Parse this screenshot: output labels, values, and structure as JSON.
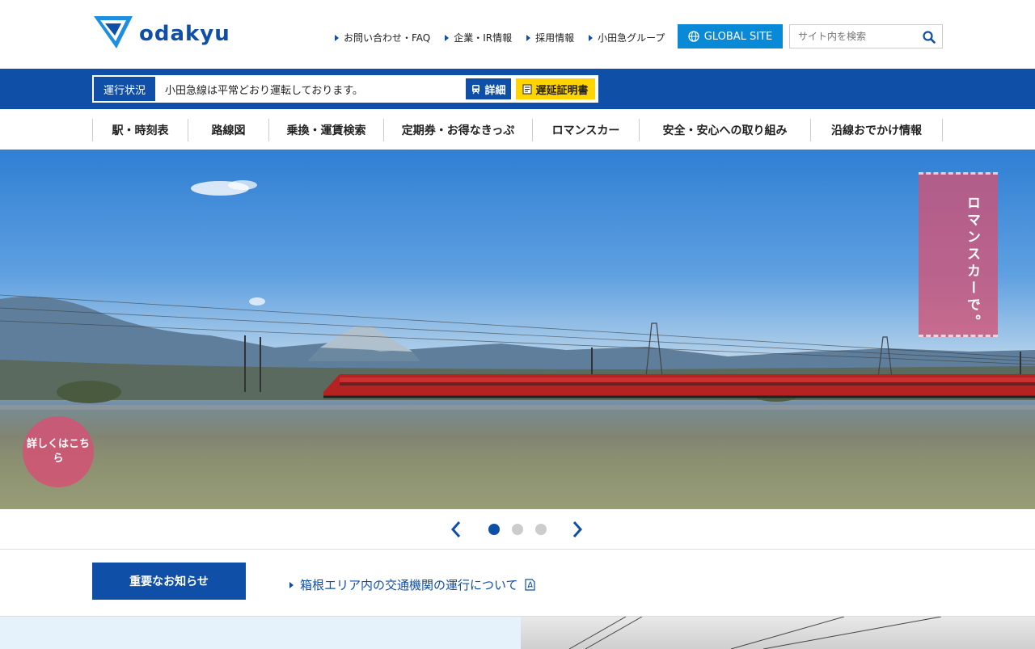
{
  "header": {
    "logo_text": "odakyu",
    "util_links": [
      "お問い合わせ・FAQ",
      "企業・IR情報",
      "採用情報",
      "小田急グループ"
    ],
    "global_site_label": "GLOBAL SITE",
    "search_placeholder": "サイト内を検索"
  },
  "operation": {
    "label": "運行状況",
    "status": "小田急線は平常どおり運転しております。",
    "detail_label": "詳細",
    "cert_label": "遅延証明書"
  },
  "nav": {
    "items": [
      "駅・時刻表",
      "路線図",
      "乗換・運賃検索",
      "定期券・お得なきっぷ",
      "ロマンスカー",
      "安全・安心への取り組み",
      "沿線おでかけ情報"
    ]
  },
  "hero": {
    "tag_text": "ロマンスカーで。",
    "detail_label": "詳しくはこちら"
  },
  "slider": {
    "total_slides": 3,
    "active_index": 0
  },
  "notice": {
    "button_label": "重要なお知らせ",
    "link_text": "箱根エリア内の交通機関の運行について"
  },
  "colors": {
    "brand_blue": "#0f4fa8",
    "global_blue": "#0a8ad6",
    "cert_yellow": "#ffd400",
    "accent_pink": "#d45274"
  }
}
